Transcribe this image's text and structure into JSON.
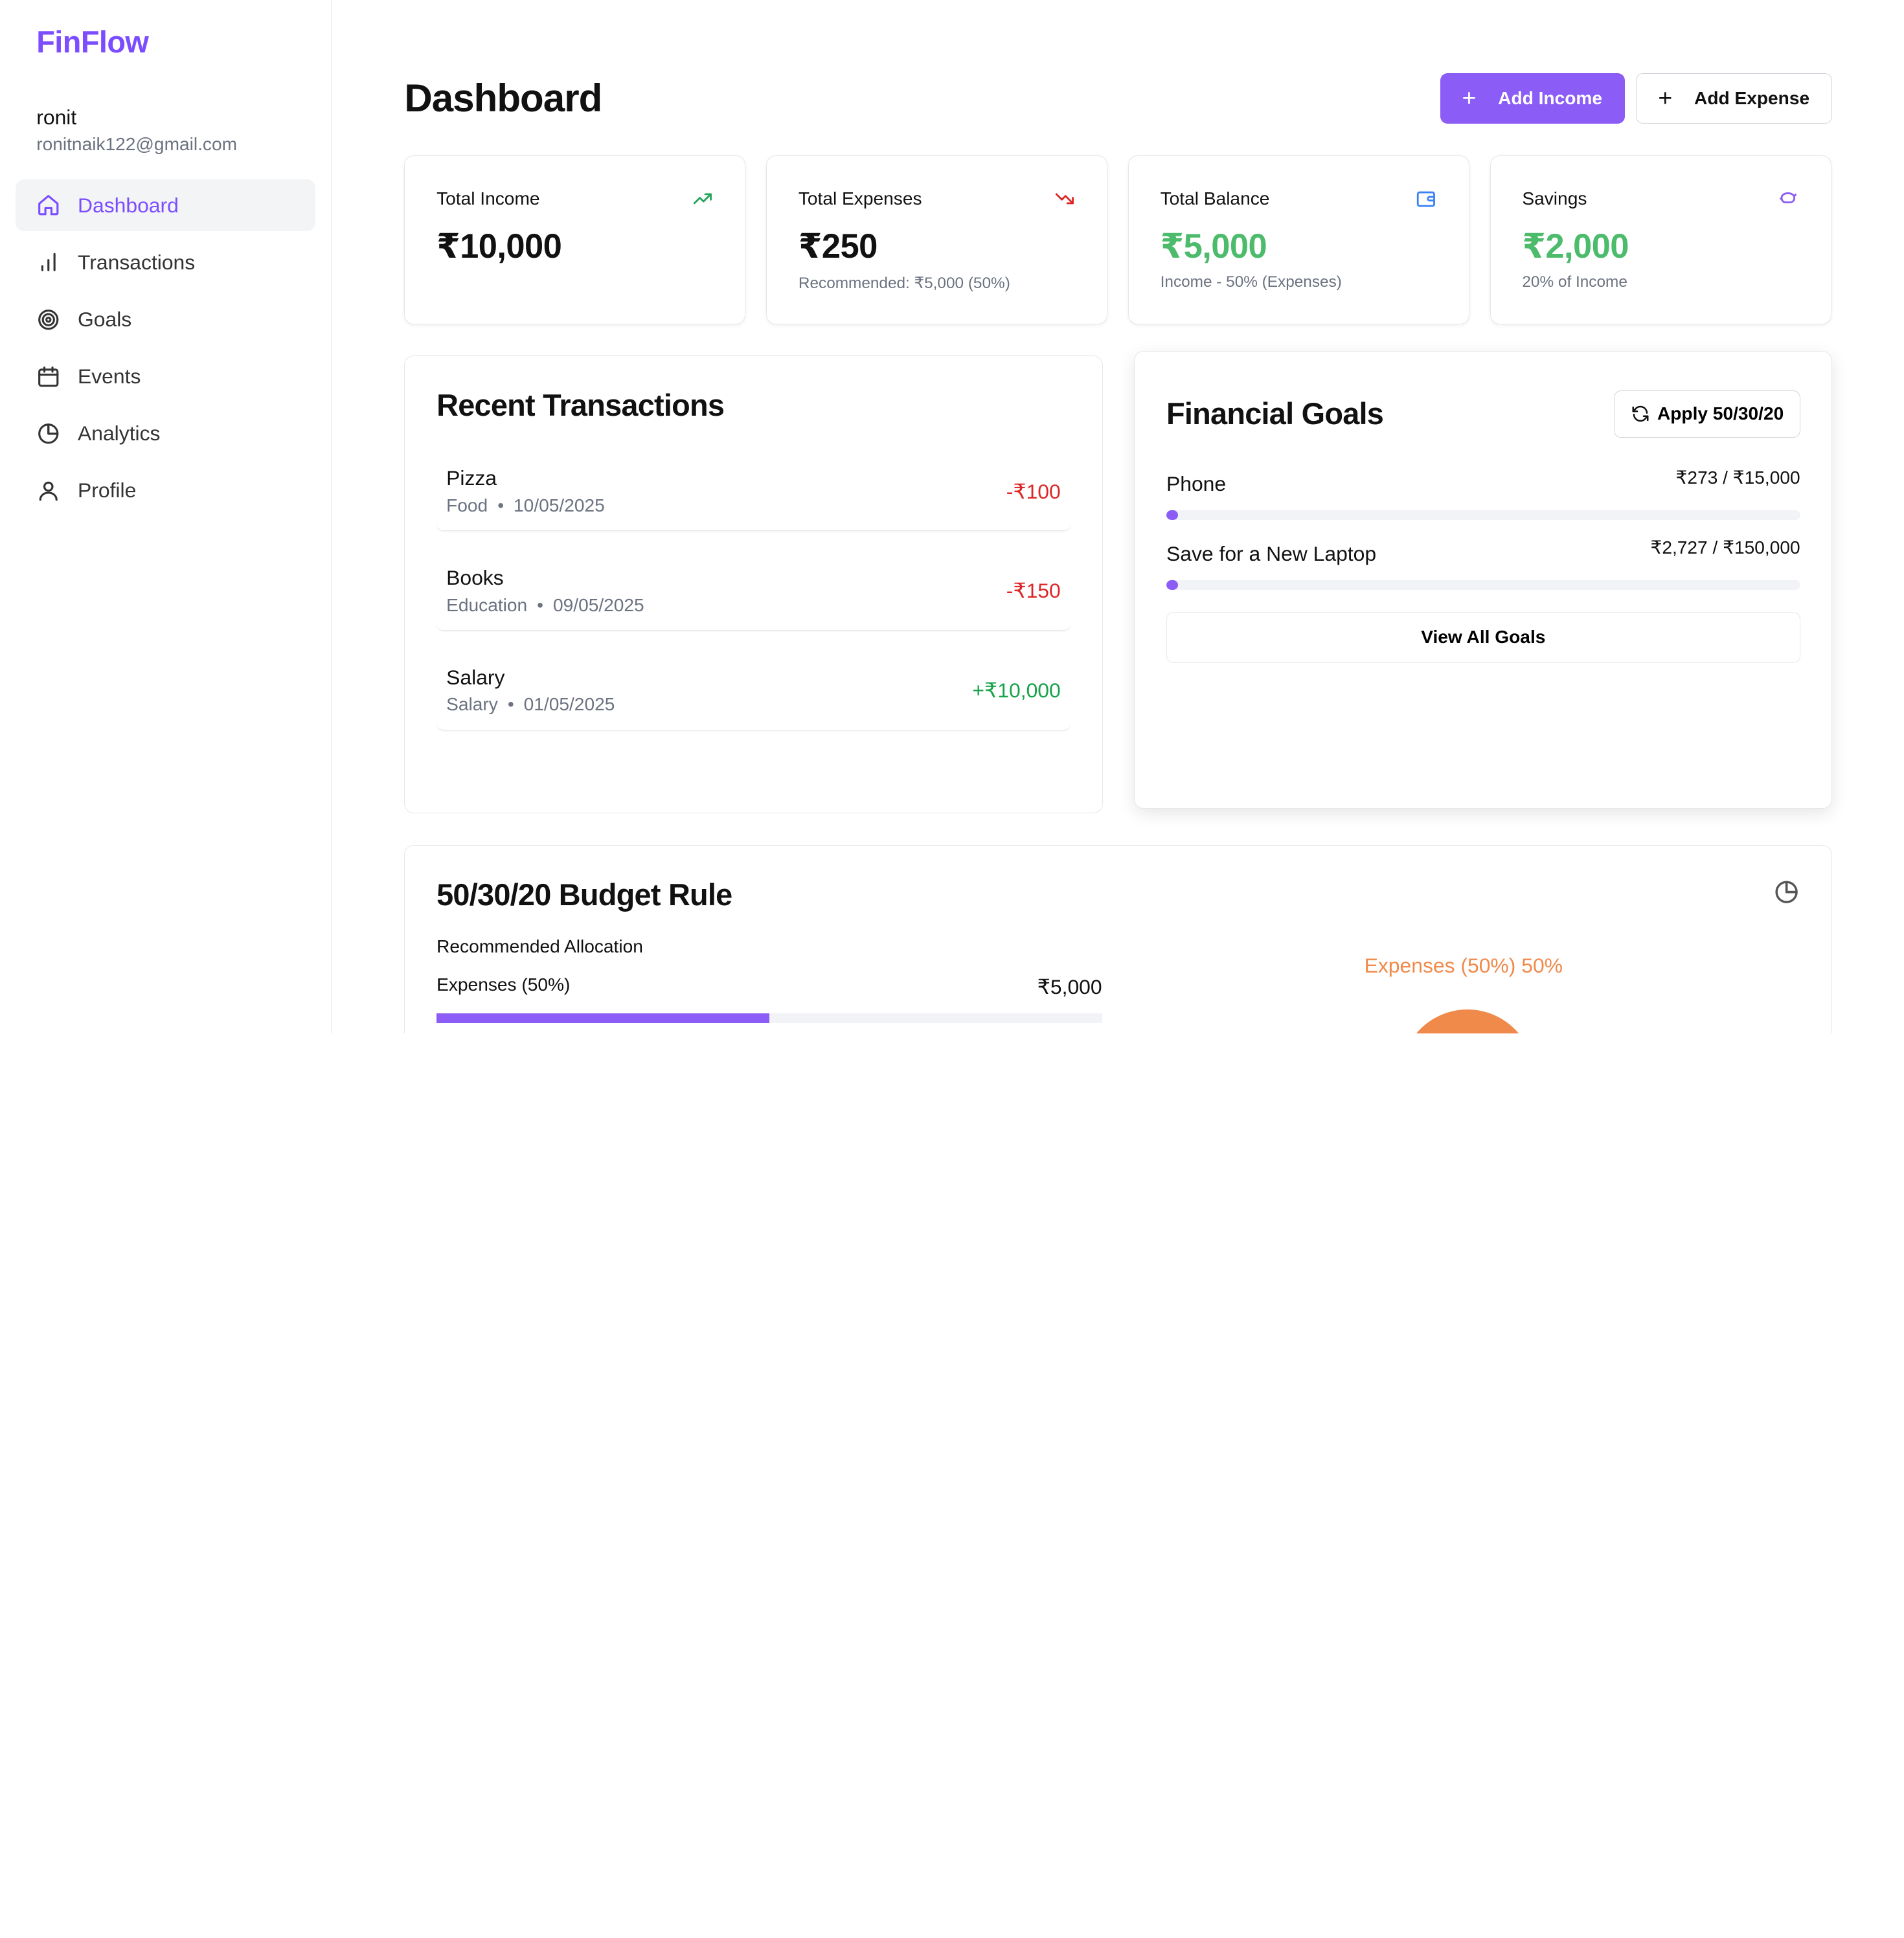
{
  "brand": "FinFlow",
  "user": {
    "name": "ronit",
    "email": "ronitnaik122@gmail.com"
  },
  "nav": [
    {
      "label": "Dashboard",
      "icon": "home-icon",
      "active": true
    },
    {
      "label": "Transactions",
      "icon": "bar-chart-icon"
    },
    {
      "label": "Goals",
      "icon": "target-icon"
    },
    {
      "label": "Events",
      "icon": "calendar-icon"
    },
    {
      "label": "Analytics",
      "icon": "pie-chart-icon"
    },
    {
      "label": "Profile",
      "icon": "user-icon"
    }
  ],
  "header": {
    "title": "Dashboard",
    "add_income": "Add Income",
    "add_expense": "Add Expense",
    "plus": "+"
  },
  "stats": [
    {
      "label": "Total Income",
      "value": "₹10,000",
      "sub": "",
      "icon": "trending-up-icon",
      "icon_color": "#22a55a"
    },
    {
      "label": "Total Expenses",
      "value": "₹250",
      "sub": "Recommended: ₹5,000 (50%)",
      "icon": "trending-down-icon",
      "icon_color": "#dc2626"
    },
    {
      "label": "Total Balance",
      "value": "₹5,000",
      "sub": "Income - 50% (Expenses)",
      "icon": "wallet-icon",
      "icon_color": "#3b82f6"
    },
    {
      "label": "Savings",
      "value": "₹2,000",
      "sub": "20% of Income",
      "icon": "piggy-bank-icon",
      "icon_color": "#8b5cf6"
    }
  ],
  "transactions": {
    "title": "Recent Transactions",
    "dot": "•",
    "items": [
      {
        "name": "Pizza",
        "category": "Food",
        "date": "10/05/2025",
        "amount": "-₹100"
      },
      {
        "name": "Books",
        "category": "Education",
        "date": "09/05/2025",
        "amount": "-₹150"
      },
      {
        "name": "Salary",
        "category": "Salary",
        "date": "01/05/2025",
        "amount": "+₹10,000"
      }
    ]
  },
  "goals": {
    "title": "Financial Goals",
    "apply_button": "Apply 50/30/20",
    "view_all": "View All Goals",
    "items": [
      {
        "name": "Phone",
        "amount": "₹273 / ₹15,000",
        "progress": 0.018
      },
      {
        "name": "Save for a New Laptop",
        "amount": "₹2,727 / ₹150,000",
        "progress": 0.018
      }
    ]
  },
  "budget": {
    "title": "50/30/20 Budget Rule",
    "subtitle": "Recommended Allocation",
    "expenses_label": "Expenses (50%)",
    "expenses_value": "₹5,000",
    "expenses_progress": 0.5,
    "pie_label": "Expenses (50%) 50%",
    "pie_color": "#f08a4b"
  },
  "colors": {
    "accent": "#8b5cf6",
    "green": "#4cbb6b",
    "red": "#dc2626"
  }
}
